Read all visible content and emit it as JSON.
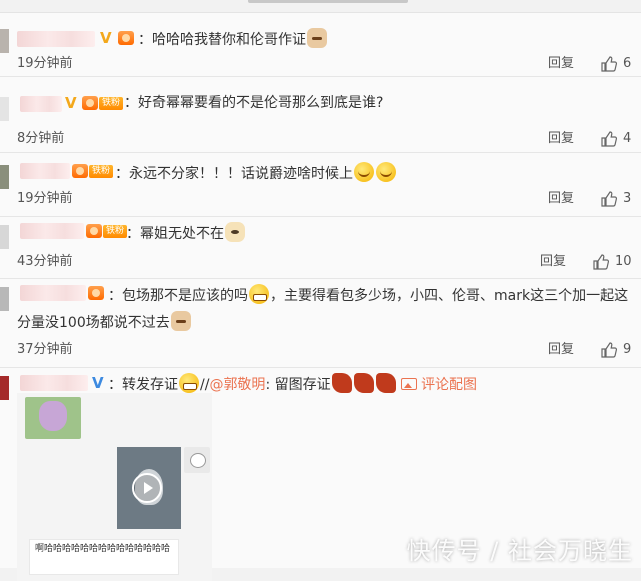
{
  "comments": [
    {
      "text": "哈哈哈我替你和伦哥作证",
      "time": "19分钟前",
      "reply_label": "回复",
      "likes": "6",
      "emojis": [
        "cat-emoji"
      ]
    },
    {
      "fans_badge": "铁粉",
      "text": "好奇幂幂要看的不是伦哥那么到底是谁?",
      "time": "8分钟前",
      "reply_label": "回复",
      "likes": "4"
    },
    {
      "fans_badge": "铁粉",
      "text": "永远不分家！！！话说爵迹啥时候上",
      "time": "19分钟前",
      "reply_label": "回复",
      "likes": "3",
      "emojis": [
        "smile-emoji",
        "smile-emoji"
      ]
    },
    {
      "fans_badge": "铁粉",
      "text": "幂姐无处不在",
      "time": "43分钟前",
      "reply_label": "回复",
      "likes": "10",
      "emojis": [
        "dog-emoji"
      ]
    },
    {
      "fans_badge": "铁粉",
      "text_line1_a": "包场那不是应该的吗",
      "text_line1_b": "，主要得看包多少场，小四、伦哥、mark这三个加一起这",
      "text_line2": "分量没100场都说不过去",
      "time": "37分钟前",
      "reply_label": "回复",
      "likes": "9",
      "emojis": [
        "grin-emoji",
        "cat-emoji"
      ]
    },
    {
      "text_a": "转发存证",
      "text_sep": "//",
      "mention": "@郭敬明",
      "text_b": ": 留图存证",
      "pic_link": "评论配图",
      "emojis": [
        "grin-emoji",
        "dragon-emoji",
        "dragon-emoji",
        "dragon-emoji"
      ],
      "screenshot_chat": "啊哈哈哈哈哈哈哈哈哈哈哈哈哈哈"
    }
  ],
  "watermark": "快传号 / 社会万晓生",
  "colors": {
    "vip_gold": "#f3a81b",
    "vip_blue": "#3d8ae0",
    "fans_badge": "#ff8a00",
    "mention": "#eb7350"
  }
}
